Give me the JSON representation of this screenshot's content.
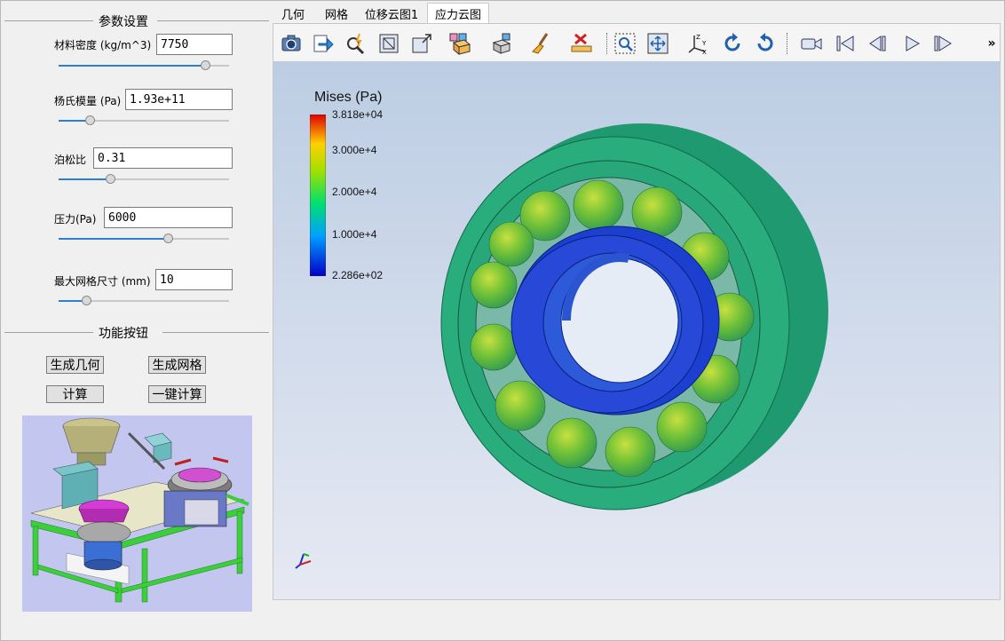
{
  "params_group": {
    "title": "参数设置"
  },
  "params": [
    {
      "label": "材料密度 (kg/m^3)",
      "value": "7750",
      "slider_fraction": 0.86
    },
    {
      "label": "杨氏模量 (Pa)",
      "value": "1.93e+11",
      "slider_fraction": 0.18
    },
    {
      "label": "泊松比",
      "value": "0.31",
      "slider_fraction": 0.3
    },
    {
      "label": "压力(Pa)",
      "value": "6000",
      "slider_fraction": 0.64
    },
    {
      "label": "最大网格尺寸 (mm)",
      "value": "10",
      "slider_fraction": 0.16
    }
  ],
  "func_group": {
    "title": "功能按钮"
  },
  "buttons": {
    "gen_geometry": "生成几何",
    "gen_mesh": "生成网格",
    "compute": "计算",
    "one_click": "一键计算"
  },
  "tabs": [
    {
      "label": "几何",
      "active": false
    },
    {
      "label": "网格",
      "active": false
    },
    {
      "label": "位移云图1",
      "active": false
    },
    {
      "label": "应力云图",
      "active": true
    }
  ],
  "toolbar_icons": [
    "camera-icon",
    "export-icon",
    "probe-icon",
    "fit-box-icon",
    "zoom-box-icon",
    "view-cube-icon",
    "view-iso-icon",
    "clear-brush-icon",
    "ruler-clear-icon",
    "zoom-region-icon",
    "pan-icon",
    "axes-orient-icon",
    "rotate-cw-icon",
    "rotate-ccw-icon",
    "video-camera-icon",
    "first-frame-icon",
    "prev-frame-icon",
    "play-icon",
    "last-frame-icon"
  ],
  "toolbar_overflow": "»",
  "colorbar": {
    "title": "Mises (Pa)",
    "labels": [
      "3.818e+04",
      "3.000e+4",
      "2.000e+4",
      "1.000e+4",
      "2.286e+02"
    ],
    "min": 228.6,
    "max": 38180
  },
  "colors": {
    "accent": "#2e7fd4",
    "outer_ring": "#2bb07e",
    "inner_ring": "#1a36c8",
    "ball": "#7cc33e",
    "background_top": "#bccde3",
    "background_bottom": "#e6e9f3"
  }
}
